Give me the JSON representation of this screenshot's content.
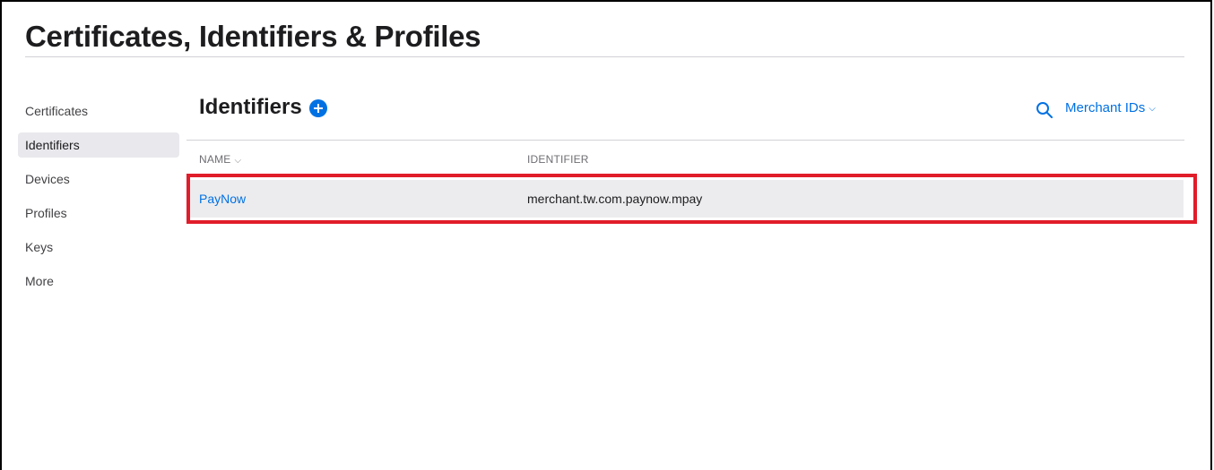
{
  "page": {
    "title": "Certificates, Identifiers & Profiles"
  },
  "sidebar": {
    "items": [
      {
        "label": "Certificates"
      },
      {
        "label": "Identifiers"
      },
      {
        "label": "Devices"
      },
      {
        "label": "Profiles"
      },
      {
        "label": "Keys"
      },
      {
        "label": "More"
      }
    ],
    "active": "Identifiers"
  },
  "section": {
    "title": "Identifiers",
    "add_icon": "plus-circle-icon"
  },
  "filter": {
    "search_icon": "search-icon",
    "selected": "Merchant IDs"
  },
  "table": {
    "columns": {
      "name": "NAME",
      "identifier": "IDENTIFIER"
    },
    "rows": [
      {
        "name": "PayNow",
        "identifier": "merchant.tw.com.paynow.mpay"
      }
    ]
  },
  "colors": {
    "accent": "#0071e3",
    "highlight": "#e11d2a"
  }
}
